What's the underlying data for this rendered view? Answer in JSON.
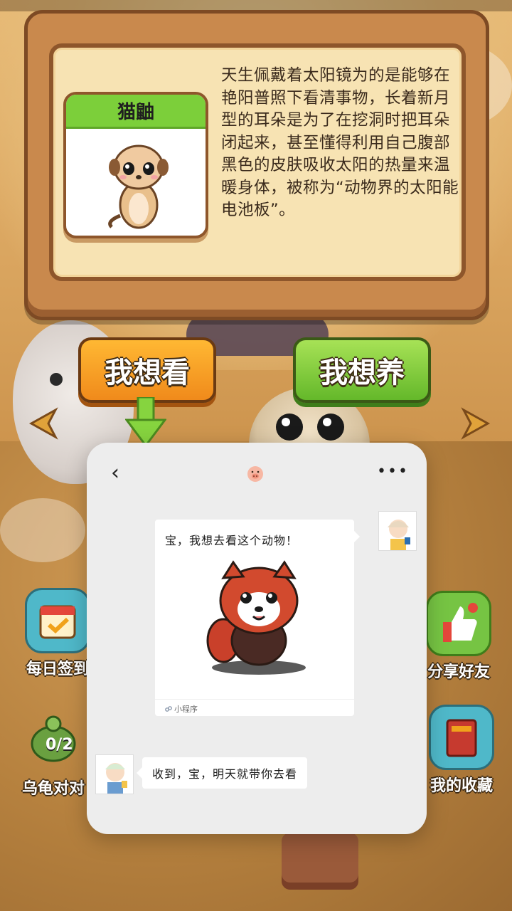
{
  "animal": {
    "name": "猫鼬",
    "description": "天生佩戴着太阳镜为的是能够在艳阳普照下看清事物，长着新月型的耳朵是为了在挖洞时把耳朵闭起来，甚至懂得利用自己腹部黑色的皮肤吸收太阳的热量来温暖身体，被称为“动物界的太阳能电池板”。"
  },
  "actions": {
    "want_to_see": "我想看",
    "want_to_raise": "我想养"
  },
  "side_menu": {
    "daily_signin": "每日签到",
    "turtle_match": "乌龟对对",
    "turtle_count": "0/2",
    "share_friends": "分享好友",
    "my_collection": "我的收藏"
  },
  "chat": {
    "message_text": "宝，我想去看这个动物！",
    "mini_program_label": "小程序",
    "reply_text": "收到，宝，明天就带你去看"
  },
  "colors": {
    "orange_button": "#f08a1b",
    "green_button": "#64b82a",
    "card_green": "#7ccf3a",
    "wood": "#c9894d"
  },
  "icons": {
    "back": "chevron-left-icon",
    "more": "more-dots-icon",
    "pig": "pig-icon"
  }
}
